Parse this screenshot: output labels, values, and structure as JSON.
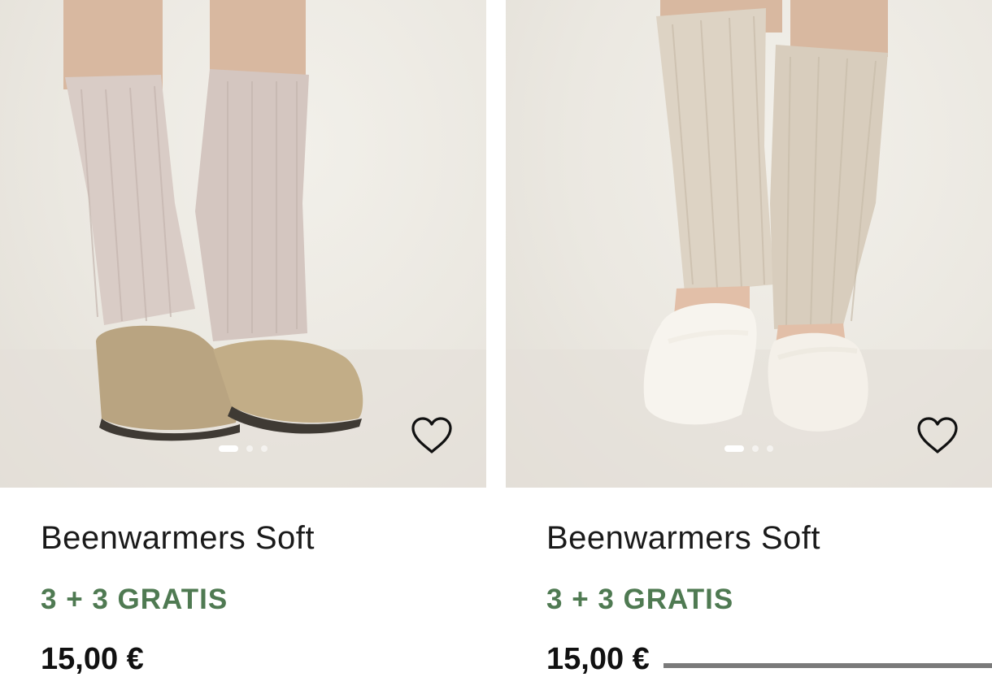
{
  "products": [
    {
      "name": "Beenwarmers Soft",
      "promo": "3 + 3 GRATIS",
      "price": "15,00 €",
      "image_alt": "Legs wearing beige knit leg warmers with suede clogs",
      "carousel_dots": 3,
      "active_dot": 0
    },
    {
      "name": "Beenwarmers Soft",
      "promo": "3 + 3 GRATIS",
      "price": "15,00 €",
      "image_alt": "Legs wearing beige knit leg warmers with white ballet flats",
      "carousel_dots": 3,
      "active_dot": 0
    }
  ],
  "icons": {
    "favorite": "heart-outline-icon"
  },
  "colors": {
    "promo": "#4f7a52",
    "price": "#111111",
    "name": "#1a1a1a"
  }
}
